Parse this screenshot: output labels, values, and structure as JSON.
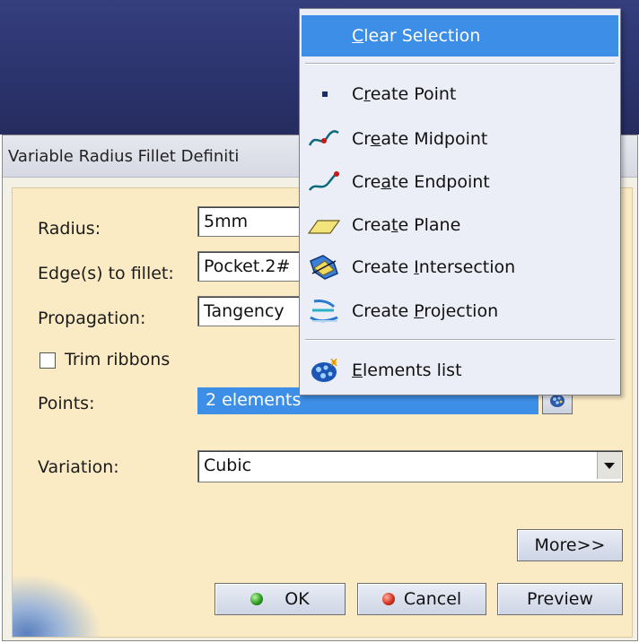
{
  "dialog": {
    "title": "Variable Radius Fillet Definiti",
    "radius_label": "Radius:",
    "radius_value": "5mm",
    "edges_label": "Edge(s) to fillet:",
    "edges_value": "Pocket.2#",
    "propagation_label": "Propagation:",
    "propagation_value": "Tangency",
    "trim_ribbons_label": "Trim ribbons",
    "trim_ribbons_checked": false,
    "points_label": "Points:",
    "points_value": "2 elements",
    "variation_label": "Variation:",
    "variation_value": "Cubic",
    "more_label": "More>>",
    "ok_label": "OK",
    "cancel_label": "Cancel",
    "preview_label": "Preview"
  },
  "context_menu": {
    "items": [
      {
        "pre": "",
        "key": "C",
        "post": "lear Selection",
        "icon": "",
        "highlighted": true
      },
      {
        "pre": "C",
        "key": "r",
        "post": "eate Point",
        "icon": "point-icon"
      },
      {
        "pre": "Cr",
        "key": "e",
        "post": "ate Midpoint",
        "icon": "midpoint-icon"
      },
      {
        "pre": "Cre",
        "key": "a",
        "post": "te Endpoint",
        "icon": "endpoint-icon"
      },
      {
        "pre": "Crea",
        "key": "t",
        "post": "e Plane",
        "icon": "plane-icon"
      },
      {
        "pre": "Create ",
        "key": "I",
        "post": "ntersection",
        "icon": "intersection-icon"
      },
      {
        "pre": "Create ",
        "key": "P",
        "post": "rojection",
        "icon": "projection-icon"
      },
      {
        "pre": "",
        "key": "E",
        "post": "lements list",
        "icon": "elements-list-icon"
      }
    ]
  },
  "colors": {
    "highlight": "#3d8ee6",
    "dialog_body": "#fbebc5",
    "background": "#2b336c"
  }
}
